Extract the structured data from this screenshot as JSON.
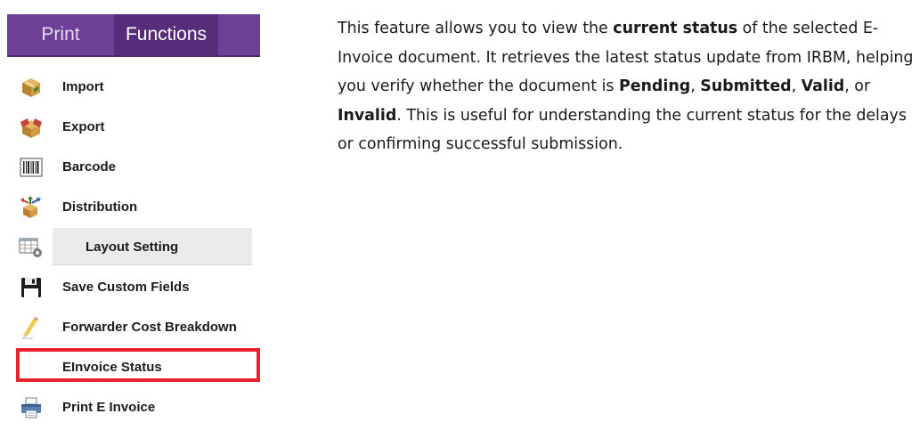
{
  "tabs": [
    {
      "label": "Print",
      "active": false
    },
    {
      "label": "Functions",
      "active": true
    }
  ],
  "menu": {
    "items": [
      {
        "label": "Import",
        "icon": "import-box-icon"
      },
      {
        "label": "Export",
        "icon": "export-box-icon"
      },
      {
        "label": "Barcode",
        "icon": "barcode-icon"
      },
      {
        "label": "Distribution",
        "icon": "distribution-icon"
      },
      {
        "label": "Layout Setting",
        "icon": "layout-grid-gear-icon"
      },
      {
        "label": "Save Custom Fields",
        "icon": "floppy-disk-icon"
      },
      {
        "label": "Forwarder Cost Breakdown",
        "icon": "pencil-icon"
      },
      {
        "label": "EInvoice Status",
        "icon": ""
      },
      {
        "label": "Print E Invoice",
        "icon": "printer-icon"
      }
    ],
    "highlighted": "EInvoice Status",
    "hovered": "Layout Setting"
  },
  "description": {
    "p1": "This feature allows you to view the ",
    "b1": "current status",
    "p2": " of the selected E-Invoice document. It retrieves the latest status update from IRBM, helping you verify whether the document is ",
    "b2": "Pending",
    "p3": ", ",
    "b3": "Submitted",
    "p4": ", ",
    "b4": "Valid",
    "p5": ", or ",
    "b5": "Invalid",
    "p6": ". This is useful for understanding the current status for the delays or confirming successful submission."
  },
  "colors": {
    "tabbar": "#6e3f96",
    "tab_active": "#562c7b",
    "highlight": "#e8232f"
  }
}
